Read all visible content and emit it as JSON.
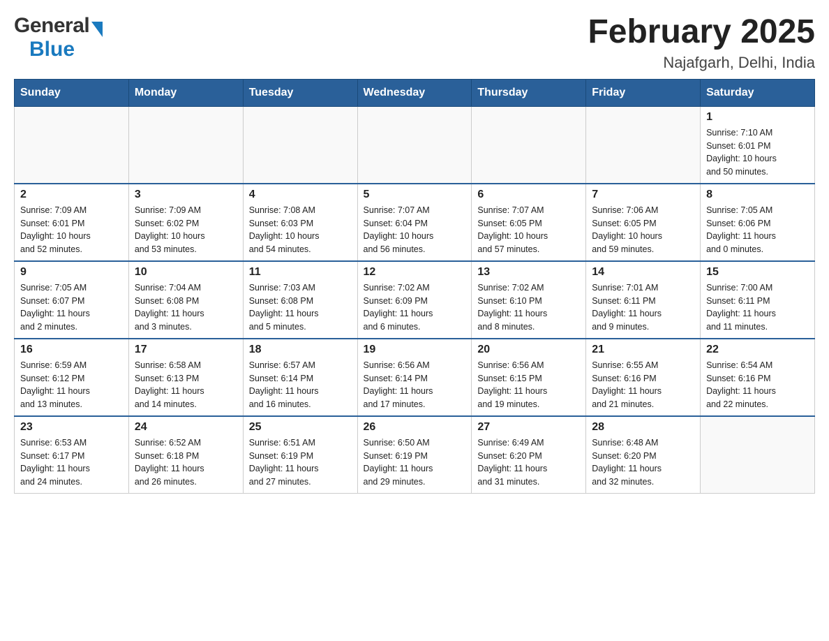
{
  "header": {
    "logo_general": "General",
    "logo_blue": "Blue",
    "month_title": "February 2025",
    "location": "Najafgarh, Delhi, India"
  },
  "weekdays": [
    "Sunday",
    "Monday",
    "Tuesday",
    "Wednesday",
    "Thursday",
    "Friday",
    "Saturday"
  ],
  "weeks": [
    [
      {
        "day": "",
        "info": ""
      },
      {
        "day": "",
        "info": ""
      },
      {
        "day": "",
        "info": ""
      },
      {
        "day": "",
        "info": ""
      },
      {
        "day": "",
        "info": ""
      },
      {
        "day": "",
        "info": ""
      },
      {
        "day": "1",
        "info": "Sunrise: 7:10 AM\nSunset: 6:01 PM\nDaylight: 10 hours\nand 50 minutes."
      }
    ],
    [
      {
        "day": "2",
        "info": "Sunrise: 7:09 AM\nSunset: 6:01 PM\nDaylight: 10 hours\nand 52 minutes."
      },
      {
        "day": "3",
        "info": "Sunrise: 7:09 AM\nSunset: 6:02 PM\nDaylight: 10 hours\nand 53 minutes."
      },
      {
        "day": "4",
        "info": "Sunrise: 7:08 AM\nSunset: 6:03 PM\nDaylight: 10 hours\nand 54 minutes."
      },
      {
        "day": "5",
        "info": "Sunrise: 7:07 AM\nSunset: 6:04 PM\nDaylight: 10 hours\nand 56 minutes."
      },
      {
        "day": "6",
        "info": "Sunrise: 7:07 AM\nSunset: 6:05 PM\nDaylight: 10 hours\nand 57 minutes."
      },
      {
        "day": "7",
        "info": "Sunrise: 7:06 AM\nSunset: 6:05 PM\nDaylight: 10 hours\nand 59 minutes."
      },
      {
        "day": "8",
        "info": "Sunrise: 7:05 AM\nSunset: 6:06 PM\nDaylight: 11 hours\nand 0 minutes."
      }
    ],
    [
      {
        "day": "9",
        "info": "Sunrise: 7:05 AM\nSunset: 6:07 PM\nDaylight: 11 hours\nand 2 minutes."
      },
      {
        "day": "10",
        "info": "Sunrise: 7:04 AM\nSunset: 6:08 PM\nDaylight: 11 hours\nand 3 minutes."
      },
      {
        "day": "11",
        "info": "Sunrise: 7:03 AM\nSunset: 6:08 PM\nDaylight: 11 hours\nand 5 minutes."
      },
      {
        "day": "12",
        "info": "Sunrise: 7:02 AM\nSunset: 6:09 PM\nDaylight: 11 hours\nand 6 minutes."
      },
      {
        "day": "13",
        "info": "Sunrise: 7:02 AM\nSunset: 6:10 PM\nDaylight: 11 hours\nand 8 minutes."
      },
      {
        "day": "14",
        "info": "Sunrise: 7:01 AM\nSunset: 6:11 PM\nDaylight: 11 hours\nand 9 minutes."
      },
      {
        "day": "15",
        "info": "Sunrise: 7:00 AM\nSunset: 6:11 PM\nDaylight: 11 hours\nand 11 minutes."
      }
    ],
    [
      {
        "day": "16",
        "info": "Sunrise: 6:59 AM\nSunset: 6:12 PM\nDaylight: 11 hours\nand 13 minutes."
      },
      {
        "day": "17",
        "info": "Sunrise: 6:58 AM\nSunset: 6:13 PM\nDaylight: 11 hours\nand 14 minutes."
      },
      {
        "day": "18",
        "info": "Sunrise: 6:57 AM\nSunset: 6:14 PM\nDaylight: 11 hours\nand 16 minutes."
      },
      {
        "day": "19",
        "info": "Sunrise: 6:56 AM\nSunset: 6:14 PM\nDaylight: 11 hours\nand 17 minutes."
      },
      {
        "day": "20",
        "info": "Sunrise: 6:56 AM\nSunset: 6:15 PM\nDaylight: 11 hours\nand 19 minutes."
      },
      {
        "day": "21",
        "info": "Sunrise: 6:55 AM\nSunset: 6:16 PM\nDaylight: 11 hours\nand 21 minutes."
      },
      {
        "day": "22",
        "info": "Sunrise: 6:54 AM\nSunset: 6:16 PM\nDaylight: 11 hours\nand 22 minutes."
      }
    ],
    [
      {
        "day": "23",
        "info": "Sunrise: 6:53 AM\nSunset: 6:17 PM\nDaylight: 11 hours\nand 24 minutes."
      },
      {
        "day": "24",
        "info": "Sunrise: 6:52 AM\nSunset: 6:18 PM\nDaylight: 11 hours\nand 26 minutes."
      },
      {
        "day": "25",
        "info": "Sunrise: 6:51 AM\nSunset: 6:19 PM\nDaylight: 11 hours\nand 27 minutes."
      },
      {
        "day": "26",
        "info": "Sunrise: 6:50 AM\nSunset: 6:19 PM\nDaylight: 11 hours\nand 29 minutes."
      },
      {
        "day": "27",
        "info": "Sunrise: 6:49 AM\nSunset: 6:20 PM\nDaylight: 11 hours\nand 31 minutes."
      },
      {
        "day": "28",
        "info": "Sunrise: 6:48 AM\nSunset: 6:20 PM\nDaylight: 11 hours\nand 32 minutes."
      },
      {
        "day": "",
        "info": ""
      }
    ]
  ]
}
